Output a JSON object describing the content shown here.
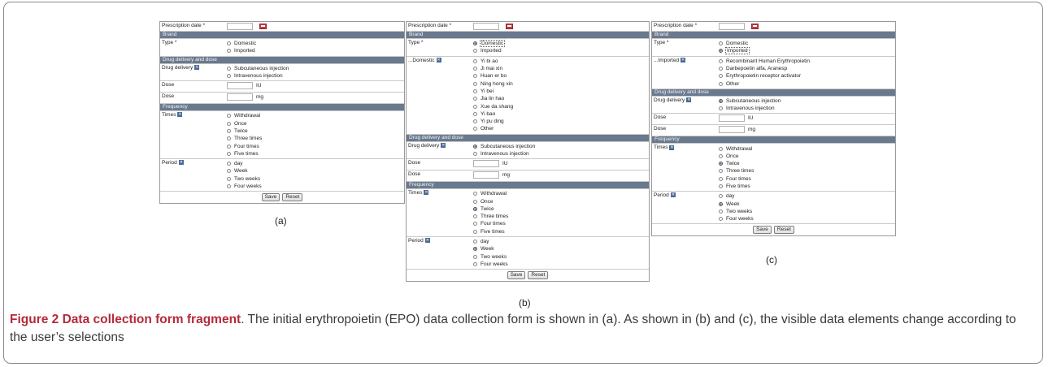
{
  "figure_caption": {
    "title": "Figure 2 Data collection form fragment",
    "text": ". The initial erythropoietin (EPO) data collection form is shown in (a). As shown in (b) and (c), the visible data elements change according to the user’s selections"
  },
  "labels": {
    "prescription_date": "Prescription date *",
    "brand": "Brand",
    "type": "Type *",
    "drug_delivery_and_dose": "Drug delivery and dose",
    "drug_delivery": "Drug delivery",
    "dose": "Dose",
    "frequency": "Frequency",
    "times": "Times",
    "period": "Period",
    "domestic_sub": "...Domestic",
    "imported_sub": "...Imported",
    "unit_iu": "IU",
    "unit_mg": "mg",
    "save": "Save",
    "reset": "Reset"
  },
  "options": {
    "type": [
      "Domestic",
      "Imported"
    ],
    "delivery": [
      "Subcutaneous injection",
      "Intravenous injection"
    ],
    "times": [
      "Withdrawal",
      "Once",
      "Twice",
      "Three times",
      "Four times",
      "Five times"
    ],
    "period": [
      "day",
      "Week",
      "Two weeks",
      "Four weeks"
    ],
    "domestic": [
      "Yi bi ao",
      "Ji mai xin",
      "Huan er bo",
      "Ning hong xin",
      "Yi bei",
      "Jia lin hao",
      "Xue da shang",
      "Yi bao",
      "Yi pu ding",
      "Other"
    ],
    "imported": [
      "Recombinant Human Erythropoietin",
      "Darbepoetin alfa, Aranesp",
      "Erythropoietin receptor activator",
      "Other"
    ]
  },
  "panels": [
    {
      "label": "(a)",
      "selected_type": null,
      "selected_delivery": null,
      "selected_times": null,
      "selected_period": null
    },
    {
      "label": "(b)",
      "selected_type": "Domestic",
      "selected_delivery": "Subcutaneous injection",
      "selected_times": "Twice",
      "selected_period": "Week"
    },
    {
      "label": "(c)",
      "selected_type": "Imported",
      "selected_delivery": "Subcutaneous injection",
      "selected_times": "Twice",
      "selected_period": "Week"
    }
  ],
  "colors": {
    "section_header": "#6a7a8e",
    "caption_title": "#b52a38",
    "radio_selected": "#3a5da8"
  }
}
